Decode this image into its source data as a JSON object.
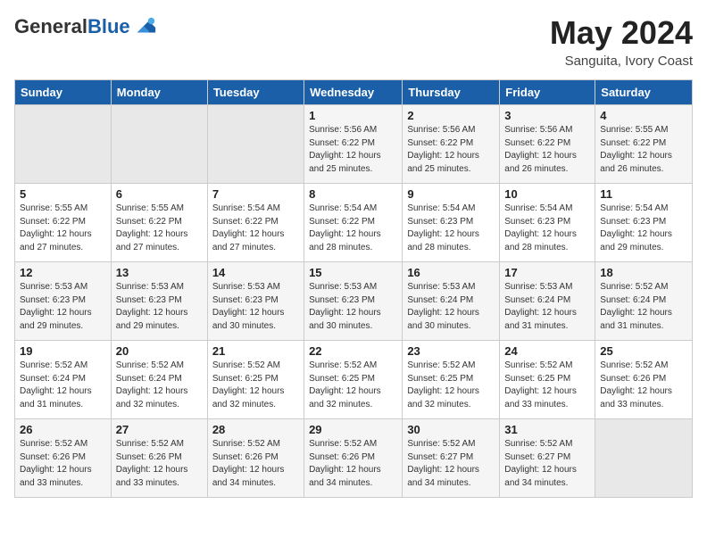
{
  "logo": {
    "general": "General",
    "blue": "Blue"
  },
  "header": {
    "month": "May 2024",
    "location": "Sanguita, Ivory Coast"
  },
  "weekdays": [
    "Sunday",
    "Monday",
    "Tuesday",
    "Wednesday",
    "Thursday",
    "Friday",
    "Saturday"
  ],
  "weeks": [
    [
      {
        "day": "",
        "sunrise": "",
        "sunset": "",
        "daylight": ""
      },
      {
        "day": "",
        "sunrise": "",
        "sunset": "",
        "daylight": ""
      },
      {
        "day": "",
        "sunrise": "",
        "sunset": "",
        "daylight": ""
      },
      {
        "day": "1",
        "sunrise": "5:56 AM",
        "sunset": "6:22 PM",
        "daylight": "12 hours and 25 minutes."
      },
      {
        "day": "2",
        "sunrise": "5:56 AM",
        "sunset": "6:22 PM",
        "daylight": "12 hours and 25 minutes."
      },
      {
        "day": "3",
        "sunrise": "5:56 AM",
        "sunset": "6:22 PM",
        "daylight": "12 hours and 26 minutes."
      },
      {
        "day": "4",
        "sunrise": "5:55 AM",
        "sunset": "6:22 PM",
        "daylight": "12 hours and 26 minutes."
      }
    ],
    [
      {
        "day": "5",
        "sunrise": "5:55 AM",
        "sunset": "6:22 PM",
        "daylight": "12 hours and 27 minutes."
      },
      {
        "day": "6",
        "sunrise": "5:55 AM",
        "sunset": "6:22 PM",
        "daylight": "12 hours and 27 minutes."
      },
      {
        "day": "7",
        "sunrise": "5:54 AM",
        "sunset": "6:22 PM",
        "daylight": "12 hours and 27 minutes."
      },
      {
        "day": "8",
        "sunrise": "5:54 AM",
        "sunset": "6:22 PM",
        "daylight": "12 hours and 28 minutes."
      },
      {
        "day": "9",
        "sunrise": "5:54 AM",
        "sunset": "6:23 PM",
        "daylight": "12 hours and 28 minutes."
      },
      {
        "day": "10",
        "sunrise": "5:54 AM",
        "sunset": "6:23 PM",
        "daylight": "12 hours and 28 minutes."
      },
      {
        "day": "11",
        "sunrise": "5:54 AM",
        "sunset": "6:23 PM",
        "daylight": "12 hours and 29 minutes."
      }
    ],
    [
      {
        "day": "12",
        "sunrise": "5:53 AM",
        "sunset": "6:23 PM",
        "daylight": "12 hours and 29 minutes."
      },
      {
        "day": "13",
        "sunrise": "5:53 AM",
        "sunset": "6:23 PM",
        "daylight": "12 hours and 29 minutes."
      },
      {
        "day": "14",
        "sunrise": "5:53 AM",
        "sunset": "6:23 PM",
        "daylight": "12 hours and 30 minutes."
      },
      {
        "day": "15",
        "sunrise": "5:53 AM",
        "sunset": "6:23 PM",
        "daylight": "12 hours and 30 minutes."
      },
      {
        "day": "16",
        "sunrise": "5:53 AM",
        "sunset": "6:24 PM",
        "daylight": "12 hours and 30 minutes."
      },
      {
        "day": "17",
        "sunrise": "5:53 AM",
        "sunset": "6:24 PM",
        "daylight": "12 hours and 31 minutes."
      },
      {
        "day": "18",
        "sunrise": "5:52 AM",
        "sunset": "6:24 PM",
        "daylight": "12 hours and 31 minutes."
      }
    ],
    [
      {
        "day": "19",
        "sunrise": "5:52 AM",
        "sunset": "6:24 PM",
        "daylight": "12 hours and 31 minutes."
      },
      {
        "day": "20",
        "sunrise": "5:52 AM",
        "sunset": "6:24 PM",
        "daylight": "12 hours and 32 minutes."
      },
      {
        "day": "21",
        "sunrise": "5:52 AM",
        "sunset": "6:25 PM",
        "daylight": "12 hours and 32 minutes."
      },
      {
        "day": "22",
        "sunrise": "5:52 AM",
        "sunset": "6:25 PM",
        "daylight": "12 hours and 32 minutes."
      },
      {
        "day": "23",
        "sunrise": "5:52 AM",
        "sunset": "6:25 PM",
        "daylight": "12 hours and 32 minutes."
      },
      {
        "day": "24",
        "sunrise": "5:52 AM",
        "sunset": "6:25 PM",
        "daylight": "12 hours and 33 minutes."
      },
      {
        "day": "25",
        "sunrise": "5:52 AM",
        "sunset": "6:26 PM",
        "daylight": "12 hours and 33 minutes."
      }
    ],
    [
      {
        "day": "26",
        "sunrise": "5:52 AM",
        "sunset": "6:26 PM",
        "daylight": "12 hours and 33 minutes."
      },
      {
        "day": "27",
        "sunrise": "5:52 AM",
        "sunset": "6:26 PM",
        "daylight": "12 hours and 33 minutes."
      },
      {
        "day": "28",
        "sunrise": "5:52 AM",
        "sunset": "6:26 PM",
        "daylight": "12 hours and 34 minutes."
      },
      {
        "day": "29",
        "sunrise": "5:52 AM",
        "sunset": "6:26 PM",
        "daylight": "12 hours and 34 minutes."
      },
      {
        "day": "30",
        "sunrise": "5:52 AM",
        "sunset": "6:27 PM",
        "daylight": "12 hours and 34 minutes."
      },
      {
        "day": "31",
        "sunrise": "5:52 AM",
        "sunset": "6:27 PM",
        "daylight": "12 hours and 34 minutes."
      },
      {
        "day": "",
        "sunrise": "",
        "sunset": "",
        "daylight": ""
      }
    ]
  ]
}
